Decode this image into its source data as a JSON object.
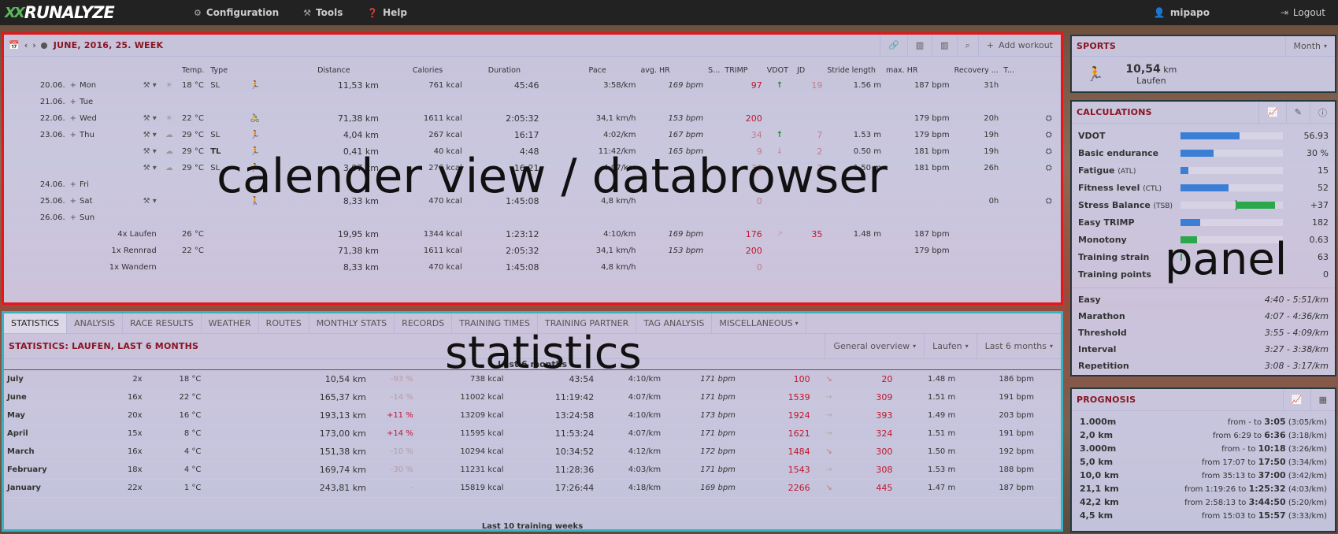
{
  "app": {
    "logo_text": "RUNALYZE",
    "logo_mark": "XX",
    "user": "mipapo",
    "logout": "Logout"
  },
  "nav": [
    {
      "label": "Configuration",
      "icon": "gear-icon"
    },
    {
      "label": "Tools",
      "icon": "tools-icon"
    },
    {
      "label": "Help",
      "icon": "help-icon"
    }
  ],
  "calendar": {
    "title": "JUNE, 2016, 25. WEEK",
    "add_label": "Add workout",
    "headers": [
      "Temp.",
      "Type",
      "Distance",
      "Calories",
      "Duration",
      "Pace",
      "avg. HR",
      "S...",
      "TRIMP",
      "VDOT",
      "JD",
      "Stride length",
      "max. HR",
      "Recovery ...",
      "T..."
    ],
    "rows": [
      {
        "date": "20.06.",
        "day": "Mon",
        "tools": true,
        "weather": "sun",
        "temp": "18 °C",
        "type": "SL",
        "sport": "run",
        "dist": "11,53 km",
        "cal": "761 kcal",
        "dur": "45:46",
        "pace": "3:58/km",
        "hr": "169 bpm",
        "trimp": "97",
        "vdot": "up",
        "jd": "19",
        "stride": "1.56 m",
        "maxhr": "187 bpm",
        "rec": "31h",
        "eq": false
      },
      {
        "date": "21.06.",
        "day": "Tue",
        "tools": false,
        "weather": "",
        "temp": "",
        "type": "",
        "sport": "",
        "dist": "",
        "cal": "",
        "dur": "",
        "pace": "",
        "hr": "",
        "trimp": "",
        "vdot": "",
        "jd": "",
        "stride": "",
        "maxhr": "",
        "rec": "",
        "eq": false
      },
      {
        "date": "22.06.",
        "day": "Wed",
        "tools": true,
        "weather": "sun",
        "temp": "22 °C",
        "type": "",
        "sport": "bike",
        "dist": "71,38 km",
        "cal": "1611 kcal",
        "dur": "2:05:32",
        "pace": "34,1 km/h",
        "hr": "153 bpm",
        "trimp": "200",
        "vdot": "",
        "jd": "",
        "stride": "",
        "maxhr": "179 bpm",
        "rec": "20h",
        "eq": true
      },
      {
        "date": "23.06.",
        "day": "Thu",
        "tools": true,
        "weather": "cloud",
        "temp": "29 °C",
        "type": "SL",
        "sport": "run",
        "dist": "4,04 km",
        "cal": "267 kcal",
        "dur": "16:17",
        "pace": "4:02/km",
        "hr": "167 bpm",
        "trimp": "34",
        "vdot": "up",
        "jd": "7",
        "stride": "1.53 m",
        "maxhr": "179 bpm",
        "rec": "19h",
        "eq": true
      },
      {
        "date": "",
        "day": "",
        "tools": true,
        "weather": "cloud",
        "temp": "29 °C",
        "type": "TL",
        "sport": "run",
        "dist": "0,41 km",
        "cal": "40 kcal",
        "dur": "4:48",
        "pace": "11:42/km",
        "hr": "165 bpm",
        "trimp": "9",
        "vdot": "down",
        "jd": "2",
        "stride": "0.50 m",
        "maxhr": "181 bpm",
        "rec": "19h",
        "eq": true
      },
      {
        "date": "",
        "day": "",
        "tools": true,
        "weather": "cloud",
        "temp": "29 °C",
        "type": "SL",
        "sport": "run",
        "dist": "3,97 km",
        "cal": "276 kcal",
        "dur": "16:21",
        "pace": "4:07/km",
        "hr": "",
        "trimp": "36",
        "vdot": "right",
        "jd": "7",
        "stride": "1.50 m",
        "maxhr": "181 bpm",
        "rec": "26h",
        "eq": true
      },
      {
        "date": "24.06.",
        "day": "Fri",
        "tools": false,
        "weather": "",
        "temp": "",
        "type": "",
        "sport": "",
        "dist": "",
        "cal": "",
        "dur": "",
        "pace": "",
        "hr": "",
        "trimp": "",
        "vdot": "",
        "jd": "",
        "stride": "",
        "maxhr": "",
        "rec": "",
        "eq": false
      },
      {
        "date": "25.06.",
        "day": "Sat",
        "tools": true,
        "weather": "",
        "temp": "",
        "type": "",
        "sport": "hike",
        "dist": "8,33 km",
        "cal": "470 kcal",
        "dur": "1:45:08",
        "pace": "4,8 km/h",
        "hr": "",
        "trimp": "0",
        "vdot": "",
        "jd": "",
        "stride": "",
        "maxhr": "",
        "rec": "0h",
        "eq": true
      },
      {
        "date": "26.06.",
        "day": "Sun",
        "tools": false,
        "weather": "",
        "temp": "",
        "type": "",
        "sport": "",
        "dist": "",
        "cal": "",
        "dur": "",
        "pace": "",
        "hr": "",
        "trimp": "",
        "vdot": "",
        "jd": "",
        "stride": "",
        "maxhr": "",
        "rec": "",
        "eq": false
      }
    ],
    "summary": [
      {
        "label": "4x Laufen",
        "temp": "26 °C",
        "dist": "19,95 km",
        "cal": "1344 kcal",
        "dur": "1:23:12",
        "pace": "4:10/km",
        "hr": "169 bpm",
        "trimp": "176",
        "vdot": "right",
        "jd": "35",
        "stride": "1.48 m",
        "maxhr": "187 bpm"
      },
      {
        "label": "1x Rennrad",
        "temp": "22 °C",
        "dist": "71,38 km",
        "cal": "1611 kcal",
        "dur": "2:05:32",
        "pace": "34,1 km/h",
        "hr": "153 bpm",
        "trimp": "200",
        "vdot": "",
        "jd": "",
        "stride": "",
        "maxhr": "179 bpm"
      },
      {
        "label": "1x Wandern",
        "temp": "",
        "dist": "8,33 km",
        "cal": "470 kcal",
        "dur": "1:45:08",
        "pace": "4,8 km/h",
        "hr": "",
        "trimp": "0",
        "vdot": "",
        "jd": "",
        "stride": "",
        "maxhr": ""
      }
    ]
  },
  "overlays": {
    "calendar": "calender view / databrowser",
    "statistics": "statistics",
    "panel": "panel"
  },
  "statistics": {
    "tabs": [
      "STATISTICS",
      "ANALYSIS",
      "RACE RESULTS",
      "WEATHER",
      "ROUTES",
      "MONTHLY STATS",
      "RECORDS",
      "TRAINING TIMES",
      "TRAINING PARTNER",
      "TAG ANALYSIS",
      "MISCELLANEOUS"
    ],
    "title": "STATISTICS: LAUFEN, LAST 6 MONTHS",
    "selects": [
      "General overview",
      "Laufen",
      "Last 6 months"
    ],
    "subtitle": "Last 6 months",
    "footer": "Last 10 training weeks",
    "rows": [
      {
        "month": "July",
        "count": "2x",
        "temp": "18 °C",
        "dist": "10,54 km",
        "pct": "-93 %",
        "cal": "738 kcal",
        "dur": "43:54",
        "pace": "4:10/km",
        "hr": "171 bpm",
        "trimp": "100",
        "trend": "down-right",
        "jd": "20",
        "stride": "1.48 m",
        "maxhr": "186 bpm"
      },
      {
        "month": "June",
        "count": "16x",
        "temp": "22 °C",
        "dist": "165,37 km",
        "pct": "-14 %",
        "cal": "11002 kcal",
        "dur": "11:19:42",
        "pace": "4:07/km",
        "hr": "171 bpm",
        "trimp": "1539",
        "trend": "right",
        "jd": "309",
        "stride": "1.51 m",
        "maxhr": "191 bpm"
      },
      {
        "month": "May",
        "count": "20x",
        "temp": "16 °C",
        "dist": "193,13 km",
        "pct": "+11 %",
        "cal": "13209 kcal",
        "dur": "13:24:58",
        "pace": "4:10/km",
        "hr": "173 bpm",
        "trimp": "1924",
        "trend": "right",
        "jd": "393",
        "stride": "1.49 m",
        "maxhr": "203 bpm"
      },
      {
        "month": "April",
        "count": "15x",
        "temp": "8 °C",
        "dist": "173,00 km",
        "pct": "+14 %",
        "cal": "11595 kcal",
        "dur": "11:53:24",
        "pace": "4:07/km",
        "hr": "171 bpm",
        "trimp": "1621",
        "trend": "right",
        "jd": "324",
        "stride": "1.51 m",
        "maxhr": "191 bpm"
      },
      {
        "month": "March",
        "count": "16x",
        "temp": "4 °C",
        "dist": "151,38 km",
        "pct": "-10 %",
        "cal": "10294 kcal",
        "dur": "10:34:52",
        "pace": "4:12/km",
        "hr": "172 bpm",
        "trimp": "1484",
        "trend": "down-right",
        "jd": "300",
        "stride": "1.50 m",
        "maxhr": "192 bpm"
      },
      {
        "month": "February",
        "count": "18x",
        "temp": "4 °C",
        "dist": "169,74 km",
        "pct": "-30 %",
        "cal": "11231 kcal",
        "dur": "11:28:36",
        "pace": "4:03/km",
        "hr": "171 bpm",
        "trimp": "1543",
        "trend": "right",
        "jd": "308",
        "stride": "1.53 m",
        "maxhr": "188 bpm"
      },
      {
        "month": "January",
        "count": "22x",
        "temp": "1 °C",
        "dist": "243,81 km",
        "pct": "-",
        "cal": "15819 kcal",
        "dur": "17:26:44",
        "pace": "4:18/km",
        "hr": "169 bpm",
        "trimp": "2266",
        "trend": "down-right",
        "jd": "445",
        "stride": "1.47 m",
        "maxhr": "187 bpm"
      }
    ]
  },
  "sports": {
    "title": "SPORTS",
    "select": "Month",
    "value": "10,54",
    "unit": "km",
    "sport": "Laufen"
  },
  "calculations": {
    "title": "CALCULATIONS",
    "rows": [
      {
        "label": "VDOT",
        "sub": "",
        "value": "56.93",
        "fill": 0.58,
        "offset": 0,
        "color": "#3a7fd5"
      },
      {
        "label": "Basic endurance",
        "sub": "",
        "value": "30 %",
        "fill": 0.32,
        "offset": 0,
        "color": "#3a7fd5"
      },
      {
        "label": "Fatigue",
        "sub": "(ATL)",
        "value": "15",
        "fill": 0.08,
        "offset": 0,
        "color": "#3a7fd5"
      },
      {
        "label": "Fitness level",
        "sub": "(CTL)",
        "value": "52",
        "fill": 0.47,
        "offset": 0,
        "color": "#3a7fd5"
      },
      {
        "label": "Stress Balance",
        "sub": "(TSB)",
        "value": "+37",
        "fill": 0.38,
        "offset": 0.54,
        "color": "#2aa84a"
      },
      {
        "label": "Easy TRIMP",
        "sub": "",
        "value": "182",
        "fill": 0.19,
        "offset": 0,
        "color": "#3a7fd5"
      },
      {
        "label": "Monotony",
        "sub": "",
        "value": "0.63",
        "fill": 0.16,
        "offset": 0,
        "color": "#2aa84a"
      },
      {
        "label": "Training strain",
        "sub": "",
        "value": "63",
        "fill": 0.015,
        "offset": 0,
        "color": "#2aa84a"
      },
      {
        "label": "Training points",
        "sub": "",
        "value": "0",
        "fill": 0,
        "offset": 0,
        "color": "#2aa84a"
      }
    ],
    "paces": [
      {
        "label": "Easy",
        "value": "4:40 - 5:51/km"
      },
      {
        "label": "Marathon",
        "value": "4:07 - 4:36/km"
      },
      {
        "label": "Threshold",
        "value": "3:55 - 4:09/km"
      },
      {
        "label": "Interval",
        "value": "3:27 - 3:38/km"
      },
      {
        "label": "Repetition",
        "value": "3:08 - 3:17/km"
      }
    ]
  },
  "prognosis": {
    "title": "PROGNOSIS",
    "rows": [
      {
        "dist": "1.000m",
        "from": "from - to",
        "to": "3:05",
        "pace": "(3:05/km)"
      },
      {
        "dist": "2,0 km",
        "from": "from 6:29 to",
        "to": "6:36",
        "pace": "(3:18/km)"
      },
      {
        "dist": "3.000m",
        "from": "from - to",
        "to": "10:18",
        "pace": "(3:26/km)"
      },
      {
        "dist": "5,0 km",
        "from": "from 17:07 to",
        "to": "17:50",
        "pace": "(3:34/km)"
      },
      {
        "dist": "10,0 km",
        "from": "from 35:13 to",
        "to": "37:00",
        "pace": "(3:42/km)"
      },
      {
        "dist": "21,1 km",
        "from": "from 1:19:26 to",
        "to": "1:25:32",
        "pace": "(4:03/km)"
      },
      {
        "dist": "42,2 km",
        "from": "from 2:58:13 to",
        "to": "3:44:50",
        "pace": "(5:20/km)"
      },
      {
        "dist": "4,5 km",
        "from": "from 15:03 to",
        "to": "15:57",
        "pace": "(3:33/km)"
      }
    ]
  }
}
